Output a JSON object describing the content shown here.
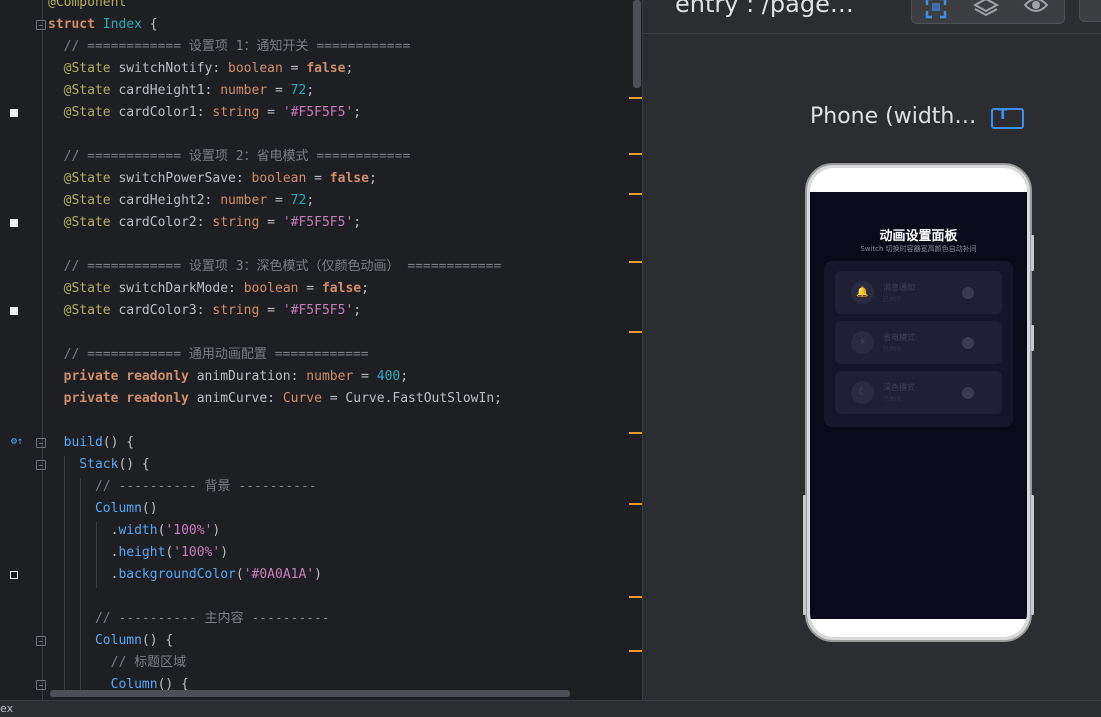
{
  "editor": {
    "lines": [
      [
        {
          "c": "dec",
          "t": "@Component"
        }
      ],
      [
        {
          "c": "kwb",
          "t": "struct "
        },
        {
          "c": "ty",
          "t": "Index"
        },
        {
          "c": "id",
          "t": " {"
        }
      ],
      [
        {
          "c": "cm",
          "t": "  // ============ 设置项 1：通知开关 ============"
        }
      ],
      [
        {
          "c": "dec",
          "t": "  @State "
        },
        {
          "c": "id",
          "t": "switchNotify: "
        },
        {
          "c": "tyo",
          "t": "boolean"
        },
        {
          "c": "id",
          "t": " = "
        },
        {
          "c": "bool",
          "t": "false"
        },
        {
          "c": "id",
          "t": ";"
        }
      ],
      [
        {
          "c": "dec",
          "t": "  @State "
        },
        {
          "c": "id",
          "t": "cardHeight1: "
        },
        {
          "c": "tyo",
          "t": "number"
        },
        {
          "c": "id",
          "t": " = "
        },
        {
          "c": "num",
          "t": "72"
        },
        {
          "c": "id",
          "t": ";"
        }
      ],
      [
        {
          "c": "dec",
          "t": "  @State "
        },
        {
          "c": "id",
          "t": "cardColor1: "
        },
        {
          "c": "tyo",
          "t": "string"
        },
        {
          "c": "id",
          "t": " = "
        },
        {
          "c": "strp",
          "t": "'#F5F5F5'"
        },
        {
          "c": "id",
          "t": ";"
        }
      ],
      [
        {
          "c": "id",
          "t": ""
        }
      ],
      [
        {
          "c": "cm",
          "t": "  // ============ 设置项 2：省电模式 ============"
        }
      ],
      [
        {
          "c": "dec",
          "t": "  @State "
        },
        {
          "c": "id",
          "t": "switchPowerSave: "
        },
        {
          "c": "tyo",
          "t": "boolean"
        },
        {
          "c": "id",
          "t": " = "
        },
        {
          "c": "bool",
          "t": "false"
        },
        {
          "c": "id",
          "t": ";"
        }
      ],
      [
        {
          "c": "dec",
          "t": "  @State "
        },
        {
          "c": "id",
          "t": "cardHeight2: "
        },
        {
          "c": "tyo",
          "t": "number"
        },
        {
          "c": "id",
          "t": " = "
        },
        {
          "c": "num",
          "t": "72"
        },
        {
          "c": "id",
          "t": ";"
        }
      ],
      [
        {
          "c": "dec",
          "t": "  @State "
        },
        {
          "c": "id",
          "t": "cardColor2: "
        },
        {
          "c": "tyo",
          "t": "string"
        },
        {
          "c": "id",
          "t": " = "
        },
        {
          "c": "strp",
          "t": "'#F5F5F5'"
        },
        {
          "c": "id",
          "t": ";"
        }
      ],
      [
        {
          "c": "id",
          "t": ""
        }
      ],
      [
        {
          "c": "cm",
          "t": "  // ============ 设置项 3：深色模式（仅颜色动画） ============"
        }
      ],
      [
        {
          "c": "dec",
          "t": "  @State "
        },
        {
          "c": "id",
          "t": "switchDarkMode: "
        },
        {
          "c": "tyo",
          "t": "boolean"
        },
        {
          "c": "id",
          "t": " = "
        },
        {
          "c": "bool",
          "t": "false"
        },
        {
          "c": "id",
          "t": ";"
        }
      ],
      [
        {
          "c": "dec",
          "t": "  @State "
        },
        {
          "c": "id",
          "t": "cardColor3: "
        },
        {
          "c": "tyo",
          "t": "string"
        },
        {
          "c": "id",
          "t": " = "
        },
        {
          "c": "strp",
          "t": "'#F5F5F5'"
        },
        {
          "c": "id",
          "t": ";"
        }
      ],
      [
        {
          "c": "id",
          "t": ""
        }
      ],
      [
        {
          "c": "cm",
          "t": "  // ============ 通用动画配置 ============"
        }
      ],
      [
        {
          "c": "kwb",
          "t": "  private readonly "
        },
        {
          "c": "id",
          "t": "animDuration: "
        },
        {
          "c": "tyo",
          "t": "number"
        },
        {
          "c": "id",
          "t": " = "
        },
        {
          "c": "num",
          "t": "400"
        },
        {
          "c": "id",
          "t": ";"
        }
      ],
      [
        {
          "c": "kwb",
          "t": "  private readonly "
        },
        {
          "c": "id",
          "t": "animCurve: "
        },
        {
          "c": "tyo",
          "t": "Curve"
        },
        {
          "c": "id",
          "t": " = Curve.FastOutSlowIn;"
        }
      ],
      [
        {
          "c": "id",
          "t": ""
        }
      ],
      [
        {
          "c": "fn",
          "t": "  build"
        },
        {
          "c": "id",
          "t": "() {"
        }
      ],
      [
        {
          "c": "fn",
          "t": "    Stack"
        },
        {
          "c": "id",
          "t": "() {"
        }
      ],
      [
        {
          "c": "cm",
          "t": "      // ---------- 背景 ----------"
        }
      ],
      [
        {
          "c": "fn",
          "t": "      Column"
        },
        {
          "c": "id",
          "t": "()"
        }
      ],
      [
        {
          "c": "id",
          "t": "        ."
        },
        {
          "c": "fn",
          "t": "width"
        },
        {
          "c": "id",
          "t": "("
        },
        {
          "c": "strp",
          "t": "'100%'"
        },
        {
          "c": "id",
          "t": ")"
        }
      ],
      [
        {
          "c": "id",
          "t": "        ."
        },
        {
          "c": "fn",
          "t": "height"
        },
        {
          "c": "id",
          "t": "("
        },
        {
          "c": "strp",
          "t": "'100%'"
        },
        {
          "c": "id",
          "t": ")"
        }
      ],
      [
        {
          "c": "id",
          "t": "        ."
        },
        {
          "c": "fn",
          "t": "backgroundColor"
        },
        {
          "c": "id",
          "t": "("
        },
        {
          "c": "strp",
          "t": "'#0A0A1A'"
        },
        {
          "c": "id",
          "t": ")"
        }
      ],
      [
        {
          "c": "id",
          "t": ""
        }
      ],
      [
        {
          "c": "cm",
          "t": "      // ---------- 主内容 ----------"
        }
      ],
      [
        {
          "c": "fn",
          "t": "      Column"
        },
        {
          "c": "id",
          "t": "() {"
        }
      ],
      [
        {
          "c": "cm",
          "t": "        // 标题区域"
        }
      ],
      [
        {
          "c": "fn",
          "t": "        Column"
        },
        {
          "c": "id",
          "t": "() {"
        }
      ]
    ]
  },
  "status_bar": {
    "file_label": "ex"
  },
  "preview": {
    "title": "entry : /page…",
    "device_label": "Phone (width…",
    "app": {
      "title": "动画设置面板",
      "subtitle": "Switch 切换时容器宽高颜色自动补间",
      "cards": [
        {
          "icon": "🔔",
          "title": "消息通知",
          "subtitle": "已关闭"
        },
        {
          "icon": "⚡",
          "title": "省电模式",
          "subtitle": "已关闭"
        },
        {
          "icon": "☾",
          "title": "深色模式",
          "subtitle": "已关闭"
        }
      ]
    }
  }
}
